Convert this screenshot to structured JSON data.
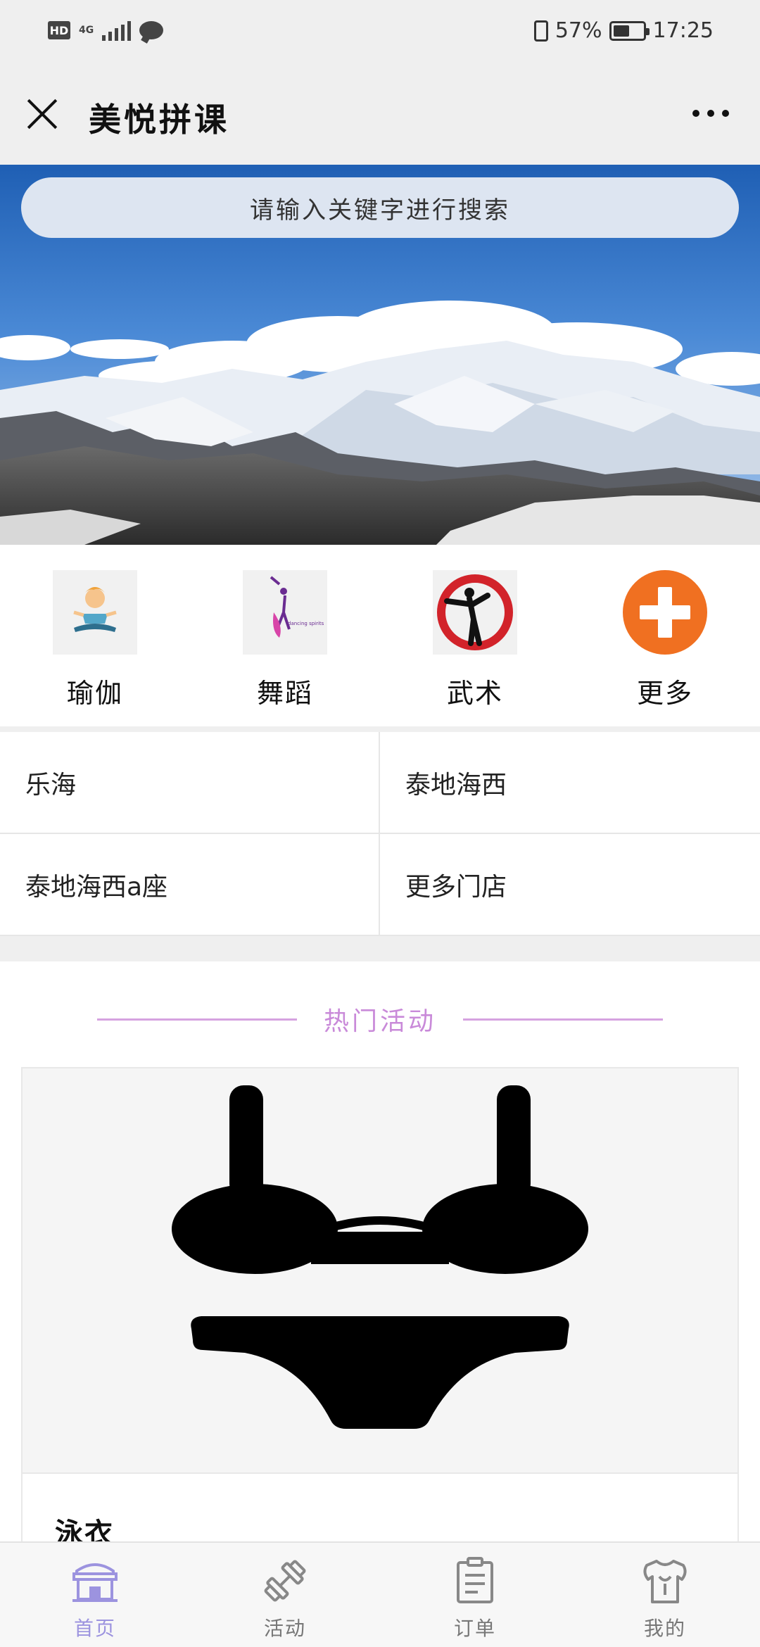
{
  "status_bar": {
    "hd": "HD",
    "network": "4G",
    "battery_percent": "57%",
    "battery_level": 0.57,
    "time": "17:25"
  },
  "titlebar": {
    "title": "美悦拼课"
  },
  "search": {
    "placeholder": "请输入关键字进行搜索"
  },
  "categories": [
    {
      "label": "瑜伽",
      "icon": "yoga-icon"
    },
    {
      "label": "舞蹈",
      "icon": "dance-icon"
    },
    {
      "label": "武术",
      "icon": "martial-arts-icon"
    },
    {
      "label": "更多",
      "icon": "plus-icon"
    }
  ],
  "dance_logo_text": "dancing spirits",
  "stores": [
    {
      "label": "乐海"
    },
    {
      "label": "泰地海西"
    },
    {
      "label": "泰地海西a座"
    },
    {
      "label": "更多门店"
    }
  ],
  "hot_section": {
    "title": "热门活动"
  },
  "activities": [
    {
      "name": "泳衣",
      "icon": "swimsuit-icon"
    }
  ],
  "tabbar": {
    "items": [
      {
        "label": "首页",
        "icon": "home-icon",
        "active": true
      },
      {
        "label": "活动",
        "icon": "dumbbell-icon",
        "active": false
      },
      {
        "label": "订单",
        "icon": "order-icon",
        "active": false
      },
      {
        "label": "我的",
        "icon": "profile-icon",
        "active": false
      }
    ]
  },
  "colors": {
    "accent": "#9c93df",
    "section_title": "#c98ad9",
    "section_line": "#d5a2e0",
    "more_button": "#f07021",
    "martial_red": "#d2232a"
  }
}
